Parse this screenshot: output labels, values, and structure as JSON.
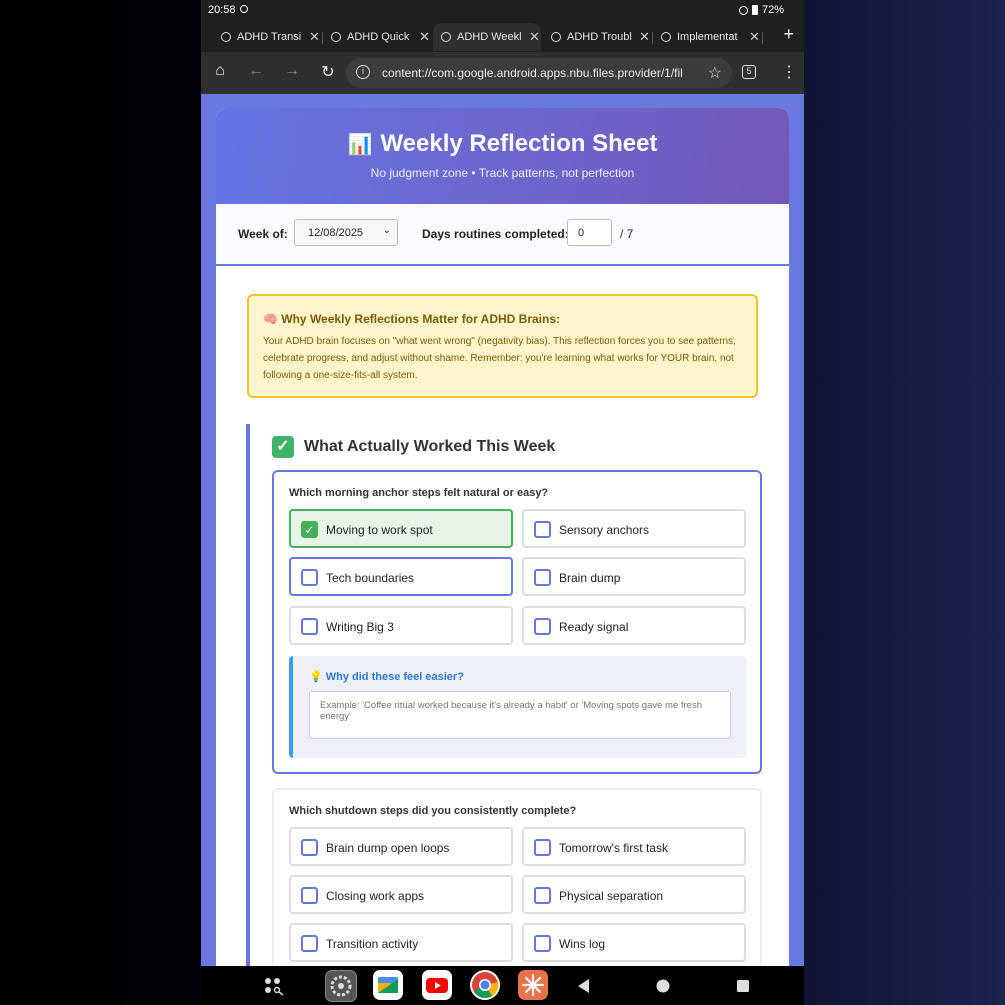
{
  "status": {
    "time": "20:58",
    "battery": "72%"
  },
  "tabs": [
    {
      "label": "ADHD Transi"
    },
    {
      "label": "ADHD Quick"
    },
    {
      "label": "ADHD Weekl"
    },
    {
      "label": "ADHD Troubl"
    },
    {
      "label": "Implementat"
    }
  ],
  "toolbar": {
    "url": "content://com.google.android.apps.nbu.files.provider/1/fil",
    "tab_count": "5"
  },
  "header": {
    "title": "Weekly Reflection Sheet",
    "icon": "📊",
    "subtitle": "No judgment zone • Track patterns, not perfection"
  },
  "week": {
    "week_label": "Week of:",
    "date": "12/08/2025",
    "days_label": "Days routines completed:",
    "days_value": "0",
    "days_total": "/ 7"
  },
  "info": {
    "heading": "🧠 Why Weekly Reflections Matter for ADHD Brains:",
    "body": "Your ADHD brain focuses on \"what went wrong\" (negativity bias). This reflection forces you to see patterns, celebrate progress, and adjust without shame. Remember: you're learning what works for YOUR brain, not following a one-size-fits-all system."
  },
  "section": {
    "title": "What Actually Worked This Week"
  },
  "morning": {
    "question": "Which morning anchor steps felt natural or easy?",
    "options": [
      {
        "label": "Moving to work spot",
        "checked": true
      },
      {
        "label": "Sensory anchors",
        "checked": false
      },
      {
        "label": "Tech boundaries",
        "checked": false
      },
      {
        "label": "Brain dump",
        "checked": false
      },
      {
        "label": "Writing Big 3",
        "checked": false
      },
      {
        "label": "Ready signal",
        "checked": false
      }
    ],
    "why_title": "💡 Why did these feel easier?",
    "why_placeholder": "Example: 'Coffee ritual worked because it's already a habit' or 'Moving spots gave me fresh energy'"
  },
  "shutdown": {
    "question": "Which shutdown steps did you consistently complete?",
    "options": [
      {
        "label": "Brain dump open loops",
        "checked": false
      },
      {
        "label": "Tomorrow's first task",
        "checked": false
      },
      {
        "label": "Closing work apps",
        "checked": false
      },
      {
        "label": "Physical separation",
        "checked": false
      },
      {
        "label": "Transition activity",
        "checked": false
      },
      {
        "label": "Wins log",
        "checked": false
      }
    ]
  },
  "colors": {
    "accent": "#6878e0",
    "checked_green": "#47b05a",
    "info_border": "#f2c230"
  }
}
